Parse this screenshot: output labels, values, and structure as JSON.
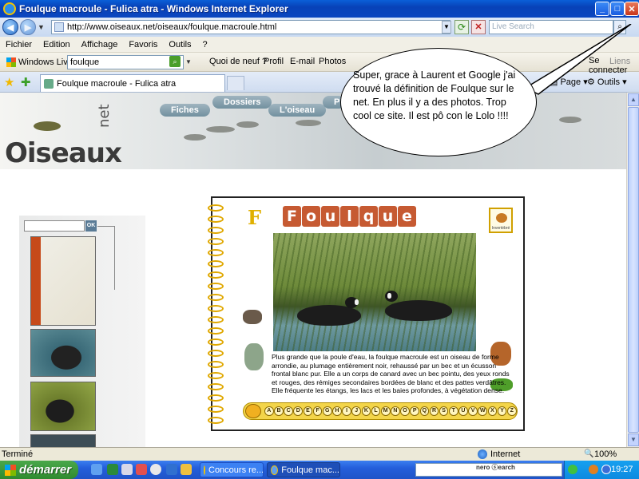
{
  "window": {
    "title": "Foulque macroule - Fulica atra - Windows Internet Explorer",
    "minimize": "_",
    "maximize": "□",
    "close": "✕"
  },
  "address": {
    "url": "http://www.oiseaux.net/oiseaux/foulque.macroule.html",
    "search_placeholder": "Live Search"
  },
  "menu": [
    "Fichier",
    "Edition",
    "Affichage",
    "Favoris",
    "Outils",
    "?"
  ],
  "live_toolbar": {
    "brand": "Windows Live",
    "search_value": "foulque",
    "links": [
      "Quoi de neuf ?",
      "Profil",
      "E-mail",
      "Photos"
    ],
    "liens": "Liens",
    "connect": "Se connecter"
  },
  "tabs": {
    "active_label": "Foulque macroule - Fulica atra",
    "page_menu": "Page",
    "tools_menu": "Outils"
  },
  "site": {
    "logo": "Oiseaux",
    "logo_suffix": "net",
    "nav": [
      "Fiches",
      "Dossiers",
      "L'oiseau",
      "Pl"
    ],
    "search_ok": "OK"
  },
  "card": {
    "letter": "F",
    "title_letters": [
      "F",
      "o",
      "u",
      "l",
      "q",
      "u",
      "e"
    ],
    "badge_text": "Invertébré",
    "description": "Plus grande que la poule d'eau, la foulque macroule est un oiseau de forme arrondie, au plumage entièrement noir, rehaussé par un bec et un écusson frontal blanc pur. Elle a un corps de canard avec un bec pointu, des yeux ronds et rouges, des rémiges secondaires bordées de blanc et des pattes verdâtres. Elle fréquente les étangs, les lacs et les baies profondes, à végétation dense.",
    "alphabet": [
      "A",
      "B",
      "C",
      "D",
      "E",
      "F",
      "G",
      "H",
      "I",
      "J",
      "K",
      "L",
      "M",
      "N",
      "O",
      "P",
      "Q",
      "R",
      "S",
      "T",
      "U",
      "V",
      "W",
      "X",
      "Y",
      "Z"
    ]
  },
  "bubble": {
    "text": "Super, grace à Laurent et Google j'ai trouvé la définition de Foulque sur le net. En plus il y a des photos. Trop cool ce site. Il est pô con le Lolo !!!!"
  },
  "status": {
    "text": "Terminé",
    "zone": "Internet",
    "zoom": "100%"
  },
  "taskbar": {
    "start": "démarrer",
    "tasks": [
      "Concours re...",
      "Foulque mac..."
    ],
    "nero": "nero ⓢearch",
    "clock": "19:27"
  }
}
